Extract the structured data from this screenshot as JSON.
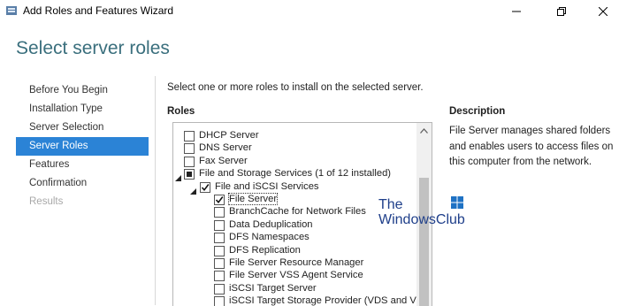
{
  "window": {
    "title": "Add Roles and Features Wizard"
  },
  "page_title": "Select server roles",
  "nav": [
    {
      "label": "Before You Begin",
      "state": "normal"
    },
    {
      "label": "Installation Type",
      "state": "normal"
    },
    {
      "label": "Server Selection",
      "state": "normal"
    },
    {
      "label": "Server Roles",
      "state": "active"
    },
    {
      "label": "Features",
      "state": "normal"
    },
    {
      "label": "Confirmation",
      "state": "normal"
    },
    {
      "label": "Results",
      "state": "disabled"
    }
  ],
  "instruction": "Select one or more roles to install on the selected server.",
  "roles_label": "Roles",
  "description_label": "Description",
  "description_text": "File Server manages shared folders and enables users to access files on this computer from the network.",
  "roles": [
    {
      "label": "DHCP Server",
      "state": "unchecked",
      "level": 0,
      "expander": "none"
    },
    {
      "label": "DNS Server",
      "state": "unchecked",
      "level": 0,
      "expander": "none"
    },
    {
      "label": "Fax Server",
      "state": "unchecked",
      "level": 0,
      "expander": "none"
    },
    {
      "label": "File and Storage Services (1 of 12 installed)",
      "state": "partial",
      "level": 0,
      "expander": "expanded"
    },
    {
      "label": "File and iSCSI Services",
      "state": "checked",
      "level": 1,
      "expander": "expanded"
    },
    {
      "label": "File Server",
      "state": "checked",
      "level": 2,
      "expander": "none",
      "selected": true
    },
    {
      "label": "BranchCache for Network Files",
      "state": "unchecked",
      "level": 2,
      "expander": "none"
    },
    {
      "label": "Data Deduplication",
      "state": "unchecked",
      "level": 2,
      "expander": "none"
    },
    {
      "label": "DFS Namespaces",
      "state": "unchecked",
      "level": 2,
      "expander": "none"
    },
    {
      "label": "DFS Replication",
      "state": "unchecked",
      "level": 2,
      "expander": "none"
    },
    {
      "label": "File Server Resource Manager",
      "state": "unchecked",
      "level": 2,
      "expander": "none"
    },
    {
      "label": "File Server VSS Agent Service",
      "state": "unchecked",
      "level": 2,
      "expander": "none"
    },
    {
      "label": "iSCSI Target Server",
      "state": "unchecked",
      "level": 2,
      "expander": "none"
    },
    {
      "label": "iSCSI Target Storage Provider (VDS and VSS h",
      "state": "unchecked",
      "level": 2,
      "expander": "none"
    }
  ],
  "watermark": {
    "line1": "The",
    "line2": "WindowsClub"
  },
  "colors": {
    "accent": "#2b83d6",
    "title": "#3a6f7d",
    "highlight": "#f5f04a"
  },
  "icons": {
    "app": "server-manager-icon",
    "minimize": "minimize-icon",
    "maximize": "restore-icon",
    "close": "close-icon",
    "scroll_up": "chevron-up-icon"
  }
}
